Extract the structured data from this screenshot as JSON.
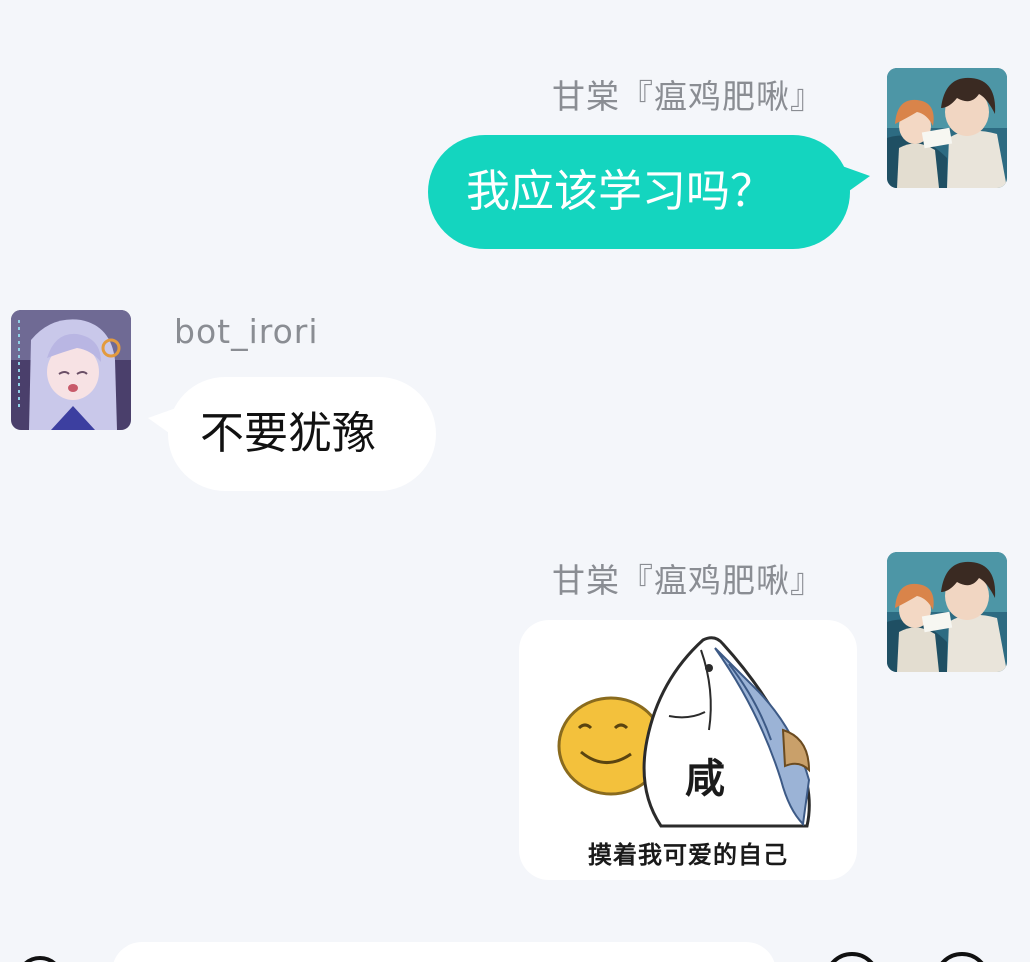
{
  "colors": {
    "background": "#f4f6fa",
    "outgoing_bubble": "#14d5bf",
    "incoming_bubble": "#ffffff",
    "name_text": "#8a8d93"
  },
  "messages": [
    {
      "direction": "outgoing",
      "sender": "甘棠『瘟鸡肥啾』",
      "type": "text",
      "text": "我应该学习吗？",
      "avatar": "anime-duo-avatar"
    },
    {
      "direction": "incoming",
      "sender": "bot_irori",
      "type": "text",
      "text": "不要犹豫",
      "avatar": "anime-girl-avatar"
    },
    {
      "direction": "outgoing",
      "sender": "甘棠『瘟鸡肥啾』",
      "type": "image",
      "sticker": {
        "fish_char": "咸",
        "caption": "摸着我可爱的自己"
      },
      "avatar": "anime-duo-avatar"
    }
  ]
}
